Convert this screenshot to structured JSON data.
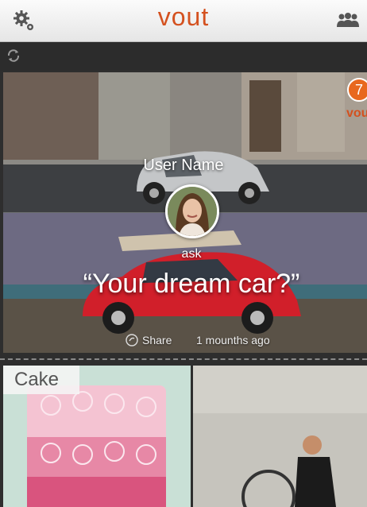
{
  "header": {
    "brand": "vout",
    "settings_icon": "gear-icon",
    "people_icon": "people-icon"
  },
  "toolbar": {
    "refresh_icon": "refresh-icon"
  },
  "poll": {
    "notification_count": "7",
    "mini_logo": "vou",
    "user_name": "User Name",
    "action": "ask",
    "question": "“Your dream car?”",
    "share_label": "Share",
    "time_ago": "1 mounths ago"
  },
  "next_card": {
    "label": "Cake"
  },
  "colors": {
    "accent": "#d4511f",
    "badge": "#e8681e"
  }
}
